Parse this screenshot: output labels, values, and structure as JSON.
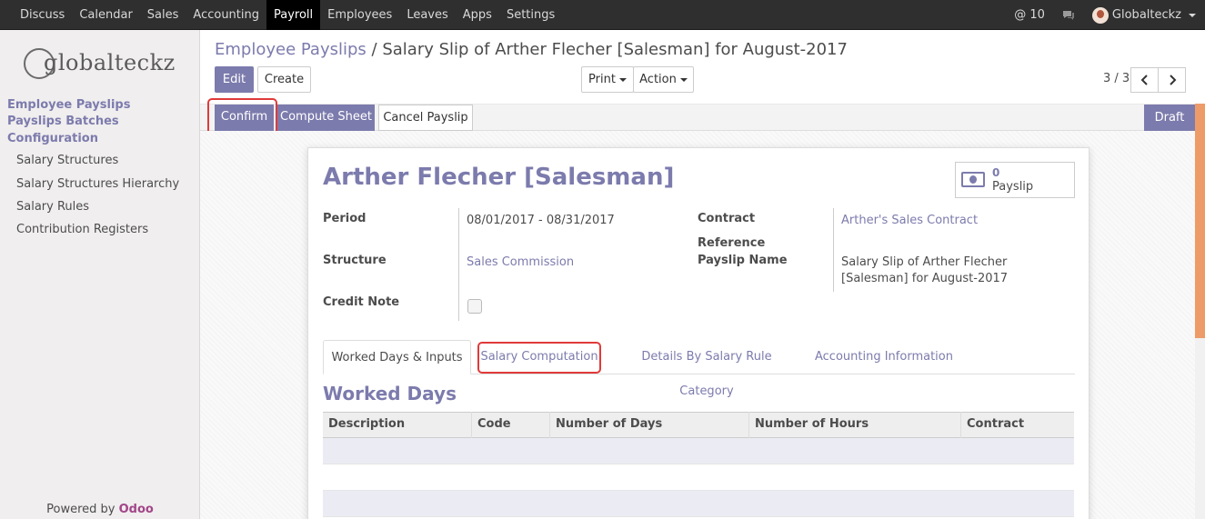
{
  "nav": {
    "items": [
      "Discuss",
      "Calendar",
      "Sales",
      "Accounting",
      "Payroll",
      "Employees",
      "Leaves",
      "Apps",
      "Settings"
    ],
    "active": "Payroll",
    "mentions": "@ 10",
    "user": "Globalteckz"
  },
  "sidebar": {
    "logo_text": "globalteckz",
    "headings": [
      "Employee Payslips",
      "Payslips Batches",
      "Configuration"
    ],
    "items": [
      "Salary Structures",
      "Salary Structures Hierarchy",
      "Salary Rules",
      "Contribution Registers"
    ],
    "powered_prefix": "Powered by",
    "powered_brand": "Odoo"
  },
  "breadcrumb": {
    "parent": "Employee Payslips",
    "separator": "/",
    "current": "Salary Slip of Arther Flecher [Salesman] for August-2017"
  },
  "toolbar": {
    "edit": "Edit",
    "create": "Create",
    "print": "Print",
    "action": "Action",
    "pager": "3 / 3",
    "prev": "‹",
    "next": "›"
  },
  "status": {
    "confirm": "Confirm",
    "compute": "Compute Sheet",
    "cancel": "Cancel Payslip",
    "state": "Draft"
  },
  "form": {
    "employee": "Arther Flecher [Salesman]",
    "smart_count": "0",
    "smart_label": "Payslip",
    "period_label": "Period",
    "period_value": "08/01/2017 - 08/31/2017",
    "structure_label": "Structure",
    "structure_value": "Sales Commission",
    "credit_label": "Credit Note",
    "contract_label": "Contract",
    "contract_value": "Arther's Sales Contract",
    "reference_label": "Reference",
    "payslip_name_label": "Payslip Name",
    "payslip_name_line1": "Salary Slip of Arther Flecher",
    "payslip_name_line2": "[Salesman] for August-2017"
  },
  "tabs": [
    "Worked Days & Inputs",
    "Salary Computation",
    "Details By Salary Rule Category",
    "Accounting Information"
  ],
  "worked_days": {
    "title": "Worked Days",
    "columns": [
      "Description",
      "Code",
      "Number of Days",
      "Number of Hours",
      "Contract"
    ]
  },
  "colors": {
    "accent": "#7c7bad",
    "highlight": "#e03a3a",
    "topbar": "#2f2f2f",
    "scroll": "#ee9b6a"
  }
}
